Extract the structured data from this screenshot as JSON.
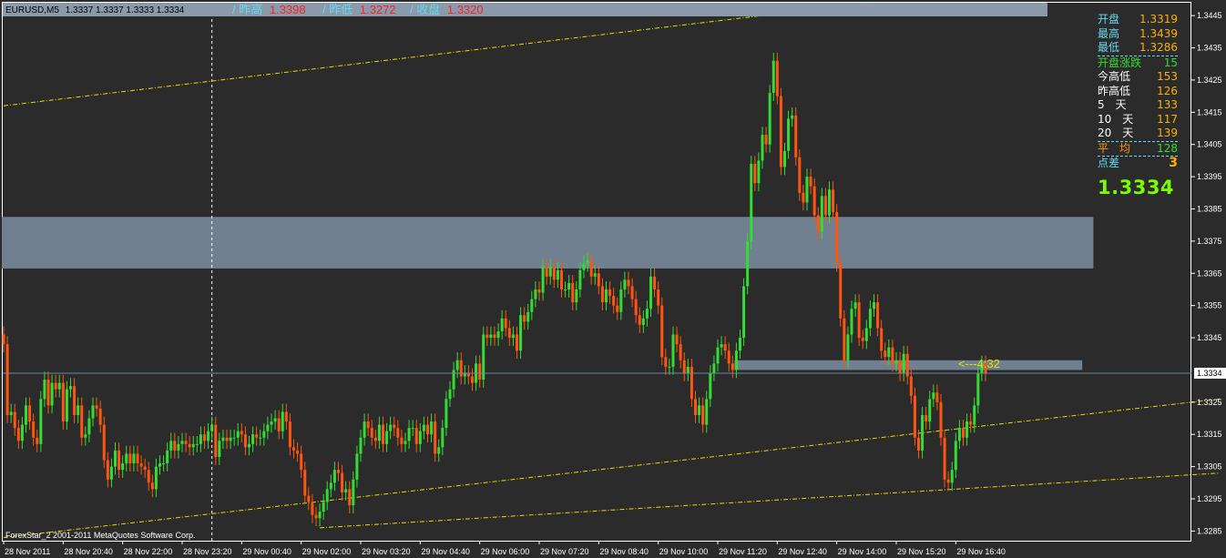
{
  "header": {
    "symbol": "EURUSD,M5",
    "ohlc": "1.3337 1.3337 1.3333 1.3334",
    "prev_high_label": "/ 昨高",
    "prev_high_value": "1.3398",
    "prev_low_label": "/ 昨低",
    "prev_low_value": "1.3272",
    "prev_close_label": "/ 收盘",
    "prev_close_value": "1.3320"
  },
  "copyright": "ForexStar_2 2001-2011 MetaQuotes Software Corp.",
  "countdown_label": "<---4:32",
  "current_price_tag": "1.3334",
  "info_panel": {
    "rows": [
      {
        "label": "开盘",
        "value": "1.3319",
        "label_color": "#66d9ef",
        "value_color": "#ffb000"
      },
      {
        "label": "最高",
        "value": "1.3439",
        "label_color": "#66d9ef",
        "value_color": "#ffb000"
      },
      {
        "label": "最低",
        "value": "1.3286",
        "label_color": "#66d9ef",
        "value_color": "#ffb000"
      },
      {
        "label": "开盘涨跌",
        "value": "15",
        "label_color": "#33dd33",
        "value_color": "#33dd33",
        "boxed": true
      },
      {
        "label": "今高低",
        "value": "153",
        "label_color": "#ffffff",
        "value_color": "#ffb000"
      },
      {
        "label": "昨高低",
        "value": "126",
        "label_color": "#ffffff",
        "value_color": "#ffb000"
      },
      {
        "label": "5　天",
        "value": "133",
        "label_color": "#ffffff",
        "value_color": "#ffb000"
      },
      {
        "label": "10　天",
        "value": "117",
        "label_color": "#ffffff",
        "value_color": "#ffb000"
      },
      {
        "label": "20　天",
        "value": "139",
        "label_color": "#ffffff",
        "value_color": "#ffb000"
      },
      {
        "label": "平　均",
        "value": "128",
        "label_color": "#ff9900",
        "value_color": "#33dd33",
        "boxed": true
      },
      {
        "label": "点差",
        "value": "3",
        "label_color": "#66d9ef",
        "value_color": "#ffb000",
        "boxed": true
      }
    ],
    "big_price": "1.3334"
  },
  "colors": {
    "background": "#2b2b2b",
    "bull": "#33dd33",
    "bear": "#ff5511",
    "zone": "#708090",
    "trend": "#e0e000",
    "price_line": "#708a9a",
    "axis_text": "#ffffff"
  },
  "chart_data": {
    "type": "candlestick",
    "symbol": "EURUSD",
    "timeframe": "M5",
    "y_ticks": [
      "1.3445",
      "1.3435",
      "1.3425",
      "1.3415",
      "1.3405",
      "1.3395",
      "1.3385",
      "1.3375",
      "1.3365",
      "1.3355",
      "1.3345",
      "1.3325",
      "1.3315",
      "1.3305",
      "1.3295",
      "1.3285"
    ],
    "y_range": [
      1.3282,
      1.3449
    ],
    "x_ticks": [
      "28 Nov 2011",
      "28 Nov 20:40",
      "28 Nov 22:00",
      "28 Nov 23:20",
      "29 Nov 00:40",
      "29 Nov 02:00",
      "29 Nov 03:20",
      "29 Nov 04:40",
      "29 Nov 06:00",
      "29 Nov 07:20",
      "29 Nov 08:40",
      "29 Nov 10:00",
      "29 Nov 11:20",
      "29 Nov 12:40",
      "29 Nov 14:00",
      "29 Nov 15:20",
      "29 Nov 16:40"
    ],
    "bars_per_tick": 16,
    "current_price": 1.3334,
    "trendlines": [
      {
        "from": [
          0,
          1.3417
        ],
        "to": [
          233,
          1.3449
        ]
      },
      {
        "from": [
          0,
          1.3283
        ],
        "to": [
          327,
          1.3326
        ]
      },
      {
        "from": [
          85,
          1.3286
        ],
        "to": [
          327,
          1.3303
        ]
      }
    ],
    "zones": [
      {
        "from_bar": 0,
        "to_bar": 293,
        "low": 1.33665,
        "high": 1.33825
      },
      {
        "from_bar": 197,
        "to_bar": 290,
        "low": 1.3335,
        "high": 1.3338
      }
    ],
    "guide_line_bar": 56,
    "closes": [
      1.3343,
      1.3321,
      1.3322,
      1.3317,
      1.3313,
      1.3318,
      1.3324,
      1.3319,
      1.3314,
      1.3312,
      1.3326,
      1.3332,
      1.3324,
      1.3331,
      1.3329,
      1.3331,
      1.3319,
      1.3329,
      1.333,
      1.3321,
      1.3324,
      1.3314,
      1.3315,
      1.332,
      1.3324,
      1.3323,
      1.3318,
      1.3307,
      1.3301,
      1.3305,
      1.331,
      1.3304,
      1.3306,
      1.3309,
      1.3306,
      1.3309,
      1.3306,
      1.3305,
      1.3304,
      1.33,
      1.3298,
      1.3305,
      1.3306,
      1.3306,
      1.331,
      1.3313,
      1.331,
      1.3312,
      1.3313,
      1.3312,
      1.3311,
      1.3312,
      1.3312,
      1.3315,
      1.3313,
      1.3316,
      1.3318,
      1.3308,
      1.3313,
      1.3314,
      1.3313,
      1.3314,
      1.3314,
      1.3316,
      1.3315,
      1.3311,
      1.3312,
      1.3315,
      1.3314,
      1.3314,
      1.3316,
      1.3318,
      1.3319,
      1.332,
      1.3316,
      1.3322,
      1.3319,
      1.3311,
      1.331,
      1.3309,
      1.3304,
      1.3296,
      1.3294,
      1.329,
      1.3289,
      1.3291,
      1.3294,
      1.3298,
      1.33,
      1.3304,
      1.3303,
      1.3297,
      1.3298,
      1.3293,
      1.3301,
      1.3309,
      1.3314,
      1.3319,
      1.3317,
      1.3314,
      1.3313,
      1.3318,
      1.3312,
      1.3316,
      1.3318,
      1.3317,
      1.3314,
      1.3312,
      1.3313,
      1.3317,
      1.3317,
      1.3312,
      1.3316,
      1.3318,
      1.3315,
      1.3319,
      1.3309,
      1.3311,
      1.3317,
      1.3326,
      1.3329,
      1.3335,
      1.3338,
      1.3333,
      1.3334,
      1.3333,
      1.3331,
      1.3337,
      1.3332,
      1.3346,
      1.3345,
      1.3346,
      1.3345,
      1.3347,
      1.3351,
      1.3348,
      1.3345,
      1.3346,
      1.3341,
      1.3352,
      1.335,
      1.3353,
      1.3357,
      1.336,
      1.3359,
      1.3367,
      1.3364,
      1.3367,
      1.3363,
      1.3366,
      1.336,
      1.336,
      1.3362,
      1.3356,
      1.336,
      1.3366,
      1.3368,
      1.3369,
      1.3364,
      1.3365,
      1.3361,
      1.3356,
      1.336,
      1.3358,
      1.3355,
      1.3353,
      1.336,
      1.3363,
      1.3361,
      1.3357,
      1.3352,
      1.3349,
      1.3351,
      1.3354,
      1.3364,
      1.336,
      1.3355,
      1.3339,
      1.3336,
      1.3336,
      1.3346,
      1.3343,
      1.3338,
      1.3334,
      1.3336,
      1.3326,
      1.3321,
      1.3324,
      1.3318,
      1.3326,
      1.3334,
      1.3337,
      1.3342,
      1.3343,
      1.3341,
      1.3337,
      1.3335,
      1.3341,
      1.3345,
      1.3361,
      1.3375,
      1.3399,
      1.3393,
      1.34,
      1.3408,
      1.3405,
      1.3421,
      1.3431,
      1.342,
      1.3398,
      1.3403,
      1.3413,
      1.3414,
      1.3401,
      1.339,
      1.3387,
      1.3395,
      1.3392,
      1.3383,
      1.3378,
      1.3389,
      1.3383,
      1.3391,
      1.3384,
      1.3368,
      1.3351,
      1.3338,
      1.3346,
      1.3354,
      1.3356,
      1.3345,
      1.3344,
      1.3348,
      1.3354,
      1.3356,
      1.3348,
      1.3341,
      1.3339,
      1.3342,
      1.3337,
      1.3338,
      1.3334,
      1.334,
      1.3333,
      1.3327,
      1.3314,
      1.331,
      1.3321,
      1.3319,
      1.3326,
      1.3328,
      1.3325,
      1.3314,
      1.3301,
      1.33,
      1.3304,
      1.3313,
      1.3317,
      1.3314,
      1.3319,
      1.3318,
      1.3324,
      1.3334,
      1.3337,
      1.3334
    ]
  }
}
